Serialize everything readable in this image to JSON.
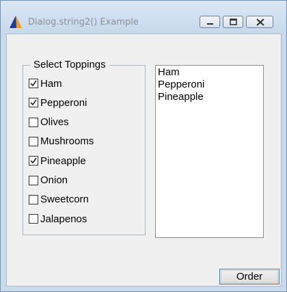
{
  "window": {
    "title": "Dialog.string2() Example",
    "app_icon": "blue-orange-triangle-icon"
  },
  "caption_buttons": {
    "minimize_icon": "minimize-icon",
    "maximize_icon": "maximize-icon",
    "close_icon": "close-icon"
  },
  "toppings_group": {
    "legend": "Select Toppings",
    "items": [
      {
        "label": "Ham",
        "checked": true
      },
      {
        "label": "Pepperoni",
        "checked": true
      },
      {
        "label": "Olives",
        "checked": false
      },
      {
        "label": "Mushrooms",
        "checked": false
      },
      {
        "label": "Pineapple",
        "checked": true
      },
      {
        "label": "Onion",
        "checked": false
      },
      {
        "label": "Sweetcorn",
        "checked": false
      },
      {
        "label": "Jalapenos",
        "checked": false
      }
    ]
  },
  "selected_list": {
    "items": [
      "Ham",
      "Pepperoni",
      "Pineapple"
    ]
  },
  "order_button": {
    "label": "Order"
  },
  "colors": {
    "title_bar": "#c9daeb",
    "client_background": "#f0f0f0",
    "button_focus_border": "#3c7fb1"
  }
}
